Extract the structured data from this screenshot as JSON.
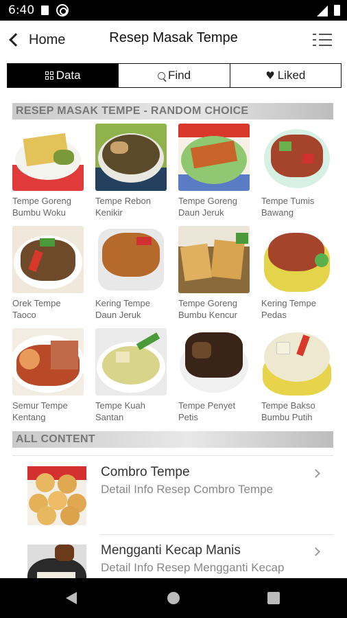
{
  "status_bar": {
    "time": "6:40"
  },
  "app_bar": {
    "back_label": "Home",
    "title": "Resep Masak Tempe"
  },
  "tabs": [
    {
      "label": "Data",
      "icon": "grid-icon",
      "active": true
    },
    {
      "label": "Find",
      "icon": "search-icon",
      "active": false
    },
    {
      "label": "Liked",
      "icon": "heart-icon",
      "active": false
    }
  ],
  "random_section": {
    "header": "RESEP MASAK TEMPE - RANDOM CHOICE",
    "items": [
      {
        "name": "Tempe Goreng\nBumbu Woku"
      },
      {
        "name": "Tempe Rebon\nKenikir"
      },
      {
        "name": "Tempe Goreng\nDaun Jeruk"
      },
      {
        "name": "Tempe Tumis\nBawang"
      },
      {
        "name": "Orek Tempe\nTaoco"
      },
      {
        "name": "Kering Tempe\nDaun Jeruk"
      },
      {
        "name": "Tempe Goreng\nBumbu Kencur"
      },
      {
        "name": "Kering Tempe\nPedas"
      },
      {
        "name": "Semur Tempe\nKentang"
      },
      {
        "name": "Tempe Kuah\nSantan"
      },
      {
        "name": "Tempe Penyet\nPetis"
      },
      {
        "name": "Tempe Bakso\nBumbu Putih"
      }
    ]
  },
  "all_content": {
    "header": "ALL CONTENT",
    "items": [
      {
        "title": "Combro Tempe",
        "subtitle": "Detail Info Resep Combro Tempe"
      },
      {
        "title": "Mengganti Kecap Manis",
        "subtitle": "Detail Info Resep Mengganti Kecap"
      }
    ]
  },
  "colors": {
    "accent": "#000000",
    "section_bar": "#d8d8d8",
    "muted_text": "#666666"
  }
}
